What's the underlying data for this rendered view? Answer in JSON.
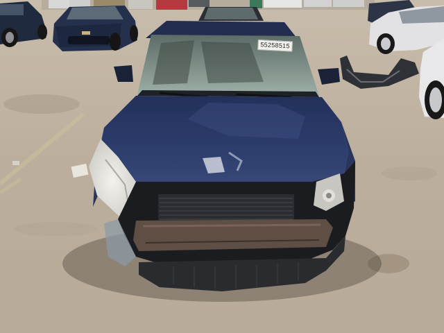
{
  "photo": {
    "windshield_sticker_text": "55258515"
  },
  "colors": {
    "lot_ground": "#bfb3a3",
    "subject_car_paint": "#2c3a66",
    "left_sedan_paint": "#24304c",
    "right_car_paint": "#e6e6e8"
  }
}
